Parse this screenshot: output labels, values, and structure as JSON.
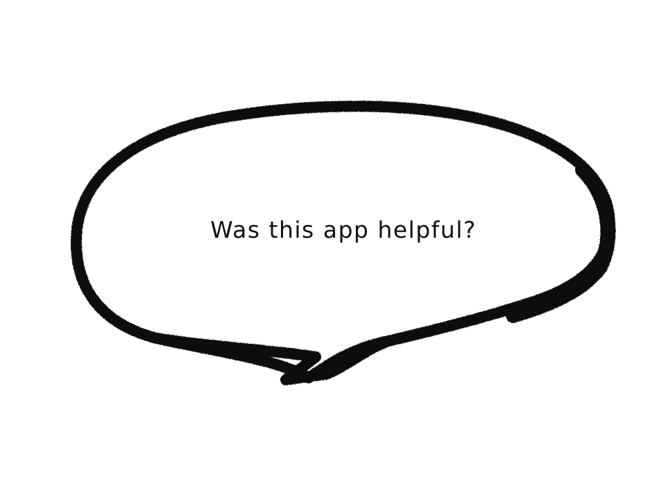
{
  "bubble": {
    "text": "Was this app helpful?",
    "stroke_color": "#0a0a0a",
    "text_color": "#111111"
  }
}
